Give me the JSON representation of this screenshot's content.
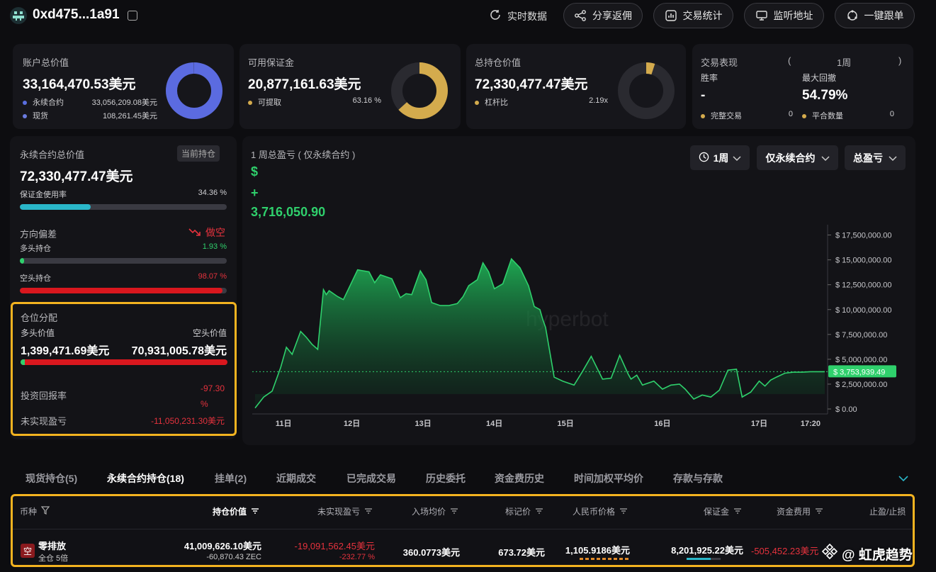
{
  "header": {
    "address": "0xd475...1a91",
    "realtime_label": "实时数据",
    "buttons": [
      "分享返佣",
      "交易统计",
      "监听地址",
      "一键跟单"
    ]
  },
  "summary": {
    "account": {
      "label": "账户总价值",
      "value": "33,164,470.53美元",
      "rows": [
        {
          "name": "永续合约",
          "value": "33,056,209.08美元",
          "color": "#5a6ee0"
        },
        {
          "name": "现货",
          "value": "108,261.45美元",
          "color": "#6a7be0"
        }
      ],
      "donut_fraction": 0.997,
      "donut_color": "#5b6be0"
    },
    "margin": {
      "label": "可用保证金",
      "value": "20,877,161.63美元",
      "row_name": "可提取",
      "row_value": "63.16 %",
      "donut_fraction": 0.6316,
      "donut_color": "#d4ab4d"
    },
    "position": {
      "label": "总持仓价值",
      "value": "72,330,477.47美元",
      "row_name": "杠杆比",
      "row_value": "2.19x",
      "donut_fraction": 0.05,
      "donut_color": "#d4ab4d"
    },
    "performance": {
      "label": "交易表现",
      "paren_open": "(",
      "period": "1周",
      "paren_close": ")",
      "winrate_label": "胜率",
      "winrate_value": "-",
      "drawdown_label": "最大回撤",
      "drawdown_value": "54.79%",
      "completed_label": "完整交易",
      "completed_value": "0",
      "closed_label": "平合数量",
      "closed_value": "0"
    }
  },
  "perp": {
    "label": "永续合约总价值",
    "badge": "当前持仓",
    "value": "72,330,477.47美元",
    "usage_label": "保证金使用率",
    "usage_value": "34.36 %",
    "usage_fraction": 0.3436,
    "bias_label": "方向偏差",
    "bias_value": "做空",
    "long_label": "多头持仓",
    "long_value": "1.93 %",
    "long_fraction": 0.0193,
    "short_label": "空头持仓",
    "short_value": "98.07 %",
    "short_fraction": 0.9807
  },
  "allocation": {
    "title": "仓位分配",
    "long_label": "多头价值",
    "short_label": "空头价值",
    "long_value": "1,399,471.69美元",
    "short_value": "70,931,005.78美元",
    "long_fraction": 0.0193,
    "roi_label": "投资回报率",
    "roi_value_1": "-97.30",
    "roi_value_2": "%",
    "upnl_label": "未实现盈亏",
    "upnl_value": "-11,050,231.30美元"
  },
  "chart_panel": {
    "title": "1 周总盈亏 ( 仅永续合约 )",
    "currency": "$",
    "sign": "+",
    "pnl_value": "3,716,050.90",
    "dropdowns": [
      "1周",
      "仅永续合约",
      "总盈亏"
    ],
    "watermark": "hyperbot"
  },
  "chart_data": {
    "type": "area",
    "y_ticks": [
      "$ 17,500,000.00",
      "$ 15,000,000.00",
      "$ 12,500,000.00",
      "$ 10,000,000.00",
      "$ 7,500,000.00",
      "$ 5,000,000.00",
      "$ 2,500,000.00",
      "$ 0.00"
    ],
    "y_tick_values": [
      17500000,
      15000000,
      12500000,
      10000000,
      7500000,
      5000000,
      2500000,
      0
    ],
    "ylim": [
      0,
      17500000
    ],
    "x_ticks": [
      "11日",
      "12日",
      "13日",
      "14日",
      "15日",
      "16日",
      "17日",
      "17:20"
    ],
    "x_tick_positions": [
      0.05,
      0.17,
      0.295,
      0.42,
      0.545,
      0.715,
      0.885,
      0.975
    ],
    "current_label": "$ 3,753,939.49",
    "current_value": 3753939.49,
    "series": [
      {
        "x": [
          0.0,
          0.015,
          0.03,
          0.045,
          0.055,
          0.065,
          0.08,
          0.09,
          0.1,
          0.11,
          0.12,
          0.125,
          0.13,
          0.145,
          0.155,
          0.165,
          0.18,
          0.2,
          0.21,
          0.22,
          0.24,
          0.255,
          0.265,
          0.275,
          0.29,
          0.3,
          0.31,
          0.325,
          0.34,
          0.355,
          0.365,
          0.375,
          0.39,
          0.4,
          0.41,
          0.42,
          0.435,
          0.45,
          0.465,
          0.48,
          0.49,
          0.5,
          0.505,
          0.51,
          0.525,
          0.54,
          0.56,
          0.575,
          0.59,
          0.61,
          0.625,
          0.64,
          0.655,
          0.66,
          0.67,
          0.68,
          0.7,
          0.715,
          0.73,
          0.745,
          0.755,
          0.77,
          0.785,
          0.8,
          0.815,
          0.83,
          0.845,
          0.855,
          0.87,
          0.885,
          0.895,
          0.905,
          0.915,
          0.93,
          0.945,
          0.96,
          0.975,
          1.0
        ],
        "y": [
          0.1,
          1.2,
          1.8,
          4.2,
          6.2,
          5.5,
          7.8,
          7.2,
          6.5,
          6.0,
          12.0,
          11.5,
          11.9,
          11.3,
          11.0,
          12.2,
          14.0,
          13.8,
          12.7,
          13.5,
          13.1,
          11.2,
          11.6,
          11.5,
          13.9,
          13.0,
          10.7,
          10.4,
          10.4,
          10.6,
          11.3,
          12.4,
          13.0,
          14.7,
          13.8,
          12.1,
          12.6,
          15.1,
          14.2,
          12.4,
          10.3,
          10.0,
          9.0,
          8.2,
          3.2,
          2.8,
          2.4,
          3.8,
          5.3,
          3.0,
          3.1,
          5.4,
          3.5,
          3.0,
          3.4,
          2.4,
          2.8,
          2.0,
          2.4,
          2.5,
          2.0,
          1.0,
          1.4,
          1.2,
          1.9,
          3.9,
          4.0,
          1.2,
          1.7,
          2.8,
          2.3,
          2.9,
          3.2,
          3.6,
          3.7,
          3.7,
          3.75,
          3.75
        ]
      }
    ]
  },
  "tabs": [
    "现货持仓(5)",
    "永续合约持仓(18)",
    "挂单(2)",
    "近期成交",
    "已完成交易",
    "历史委托",
    "资金费历史",
    "时间加权平均价",
    "存款与存款"
  ],
  "table": {
    "headers": [
      "币种",
      "持仓价值",
      "未实现盈亏",
      "入场均价",
      "标记价",
      "人民币价格",
      "保证金",
      "资金费用",
      "止盈/止损"
    ],
    "row": {
      "coin_badge": "空",
      "coin": "零排放",
      "mode": "全仓 5倍",
      "value": "41,009,626.10美元",
      "value_sub": "-60,870.43 ZEC",
      "upnl": "-19,091,562.45美元",
      "upnl_pct": "-232.77 %",
      "entry": "360.0773美元",
      "mark": "673.72美元",
      "cny": "1,105.9186美元",
      "margin": "8,201,925.22美元",
      "funding": "-505,452.23美元"
    }
  },
  "watermark_brand": "@ 虹虎趋势",
  "colors": {
    "accent_yellow": "#f3b320",
    "green": "#2fd06c",
    "red": "#e5323d",
    "cyan": "#2ab7c9"
  }
}
